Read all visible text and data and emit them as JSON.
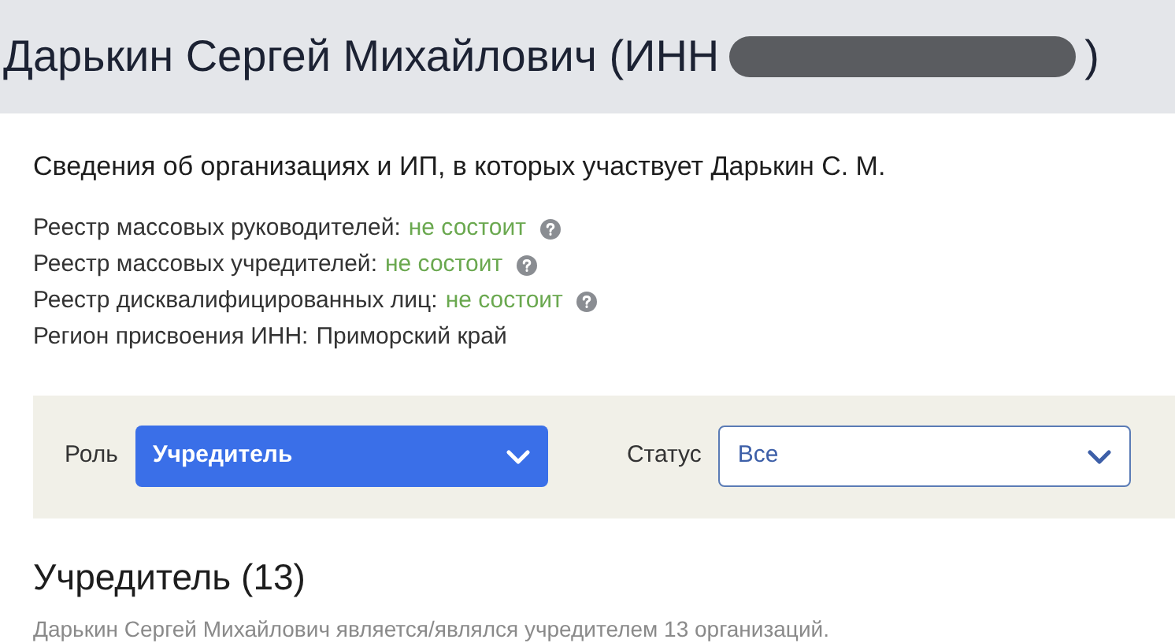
{
  "header": {
    "title": "Дарькин Сергей Михайлович (ИНН",
    "redacted": true,
    "title_end": ")"
  },
  "subtitle": "Сведения об организациях и ИП, в которых участвует Дарькин С. М.",
  "registries": [
    {
      "kind": "status",
      "label": "Реестр массовых руководителей:",
      "value": "не состоит",
      "help": true
    },
    {
      "kind": "status",
      "label": "Реестр массовых учредителей:",
      "value": "не состоит",
      "help": true
    },
    {
      "kind": "status",
      "label": "Реестр дисквалифицированных лиц:",
      "value": "не состоит",
      "help": true
    },
    {
      "kind": "plain",
      "label": "Регион присвоения ИНН:",
      "value": "Приморский край",
      "help": false
    }
  ],
  "filters": [
    {
      "label": "Роль",
      "value": "Учредитель",
      "active": true
    },
    {
      "label": "Статус",
      "value": "Все",
      "active": false
    }
  ],
  "section": {
    "title": "Учредитель (13)",
    "description": "Дарькин Сергей Михайлович является/являлся учредителем 13 организаций."
  }
}
